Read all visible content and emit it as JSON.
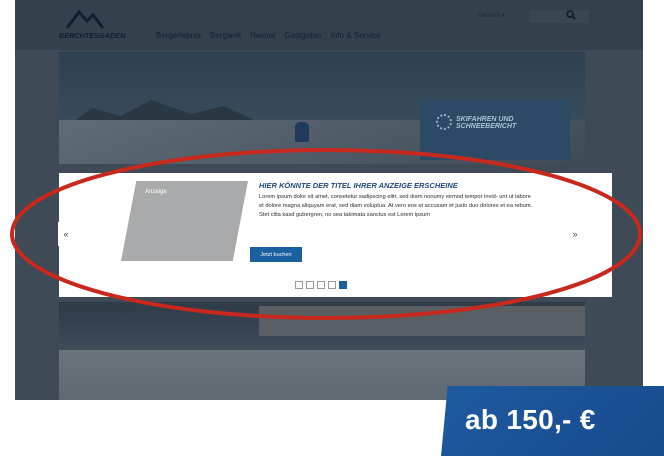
{
  "header": {
    "logo_text": "BERCHTESGADEN",
    "nav": [
      "Bergerlebnis",
      "Bergwelt",
      "Heimat",
      "Gastgeber",
      "Info & Service"
    ],
    "language": "Deutsch ▾"
  },
  "hero": {
    "banner_text": "SKIFAHREN UND SCHNEEBERICHT"
  },
  "ad": {
    "image_label": "Anzeige",
    "title": "HIER KÖNNTE DER TITEL IHRER ANZEIGE ERSCHEINE",
    "body": "Lorem ipsum dolor sit amet, consetetur sadipscing elitr, sed diam nonumy eirmod tempor invid- unt ut labore et dolore magna aliquyam erat, sed diam voluptua. At vero eos et accusam et justo duo dolores et ea rebum. Stet clita kasd gubergren, no sea takimata sanctus est Lorem ipsum",
    "cta": "Jetzt buchen",
    "slides_total": 5,
    "active_slide": 5
  },
  "carousel": {
    "prev_label": "«",
    "next_label": "»"
  },
  "price": {
    "label": "ab 150,- €"
  },
  "colors": {
    "accent": "#1a5fa0",
    "highlight_ring": "#c8281e",
    "price_badge": "#1f5aa0"
  },
  "icons": [
    "mountain-logo-icon",
    "search-icon",
    "gear-icon",
    "chevron-left-icon",
    "chevron-right-icon"
  ]
}
